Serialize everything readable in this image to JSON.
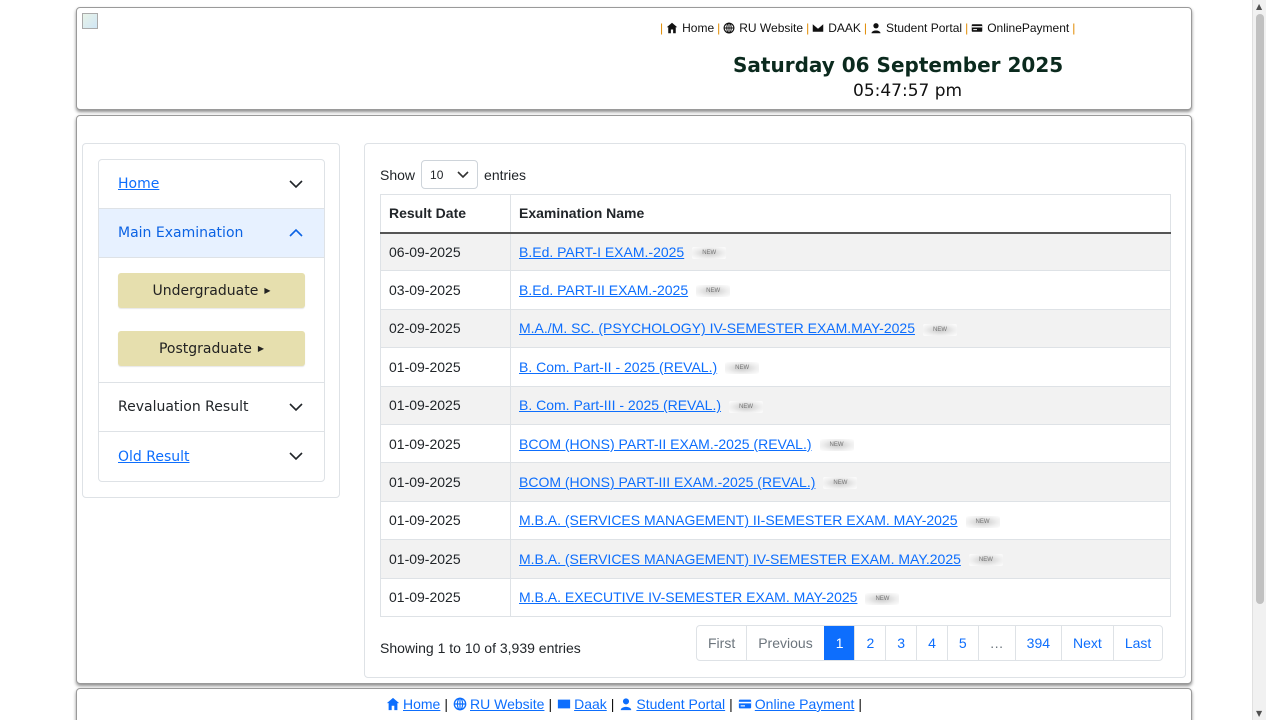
{
  "header": {
    "nav": [
      {
        "label": "Home",
        "icon": "home-icon"
      },
      {
        "label": "RU Website",
        "icon": "globe-icon"
      },
      {
        "label": "DAAK",
        "icon": "envelope-icon"
      },
      {
        "label": "Student Portal",
        "icon": "user-icon"
      },
      {
        "label": "OnlinePayment",
        "icon": "card-icon"
      }
    ],
    "date": "Saturday 06 September 2025",
    "time": "05:47:57 pm"
  },
  "sidebar": {
    "items": [
      {
        "label": "Home"
      },
      {
        "label": "Main Examination"
      },
      {
        "label": "Revaluation Result"
      },
      {
        "label": "Old Result"
      }
    ],
    "sub_buttons": [
      "Undergraduate",
      "Postgraduate"
    ]
  },
  "table_controls": {
    "show_label": "Show",
    "entries_value": "10",
    "entries_label": "entries"
  },
  "table": {
    "headers": [
      "Result Date",
      "Examination Name"
    ],
    "badge_text": "NEW",
    "rows": [
      {
        "date": "06-09-2025",
        "name": "B.Ed. PART-I EXAM.-2025"
      },
      {
        "date": "03-09-2025",
        "name": "B.Ed. PART-II EXAM.-2025"
      },
      {
        "date": "02-09-2025",
        "name": "M.A./M. SC. (PSYCHOLOGY) IV-SEMESTER EXAM.MAY-2025"
      },
      {
        "date": "01-09-2025",
        "name": "B. Com. Part-II - 2025 (REVAL.)"
      },
      {
        "date": "01-09-2025",
        "name": "B. Com. Part-III - 2025 (REVAL.)"
      },
      {
        "date": "01-09-2025",
        "name": "BCOM (HONS) PART-II EXAM.-2025 (REVAL.)"
      },
      {
        "date": "01-09-2025",
        "name": "BCOM (HONS) PART-III EXAM.-2025 (REVAL.)"
      },
      {
        "date": "01-09-2025",
        "name": "M.B.A. (SERVICES MANAGEMENT) II-SEMESTER EXAM. MAY-2025"
      },
      {
        "date": "01-09-2025",
        "name": "M.B.A. (SERVICES MANAGEMENT) IV-SEMESTER EXAM. MAY.2025"
      },
      {
        "date": "01-09-2025",
        "name": "M.B.A. EXECUTIVE IV-SEMESTER EXAM. MAY-2025"
      }
    ]
  },
  "pagination": {
    "info": "Showing 1 to 10 of 3,939 entries",
    "first": "First",
    "previous": "Previous",
    "pages": [
      "1",
      "2",
      "3",
      "4",
      "5",
      "…",
      "394"
    ],
    "next": "Next",
    "last": "Last"
  },
  "footer": {
    "links": [
      {
        "label": "Home",
        "icon": "home-icon"
      },
      {
        "label": "RU Website",
        "icon": "globe-icon"
      },
      {
        "label": "Daak",
        "icon": "envelope-icon"
      },
      {
        "label": "Student Portal",
        "icon": "user-icon"
      },
      {
        "label": "Online Payment",
        "icon": "card-icon"
      }
    ]
  },
  "colors": {
    "accent": "#0d6efd",
    "sub_button_bg": "#e6dfae",
    "active_item_bg": "#e7f1ff",
    "date_text": "#0b2a1e"
  }
}
